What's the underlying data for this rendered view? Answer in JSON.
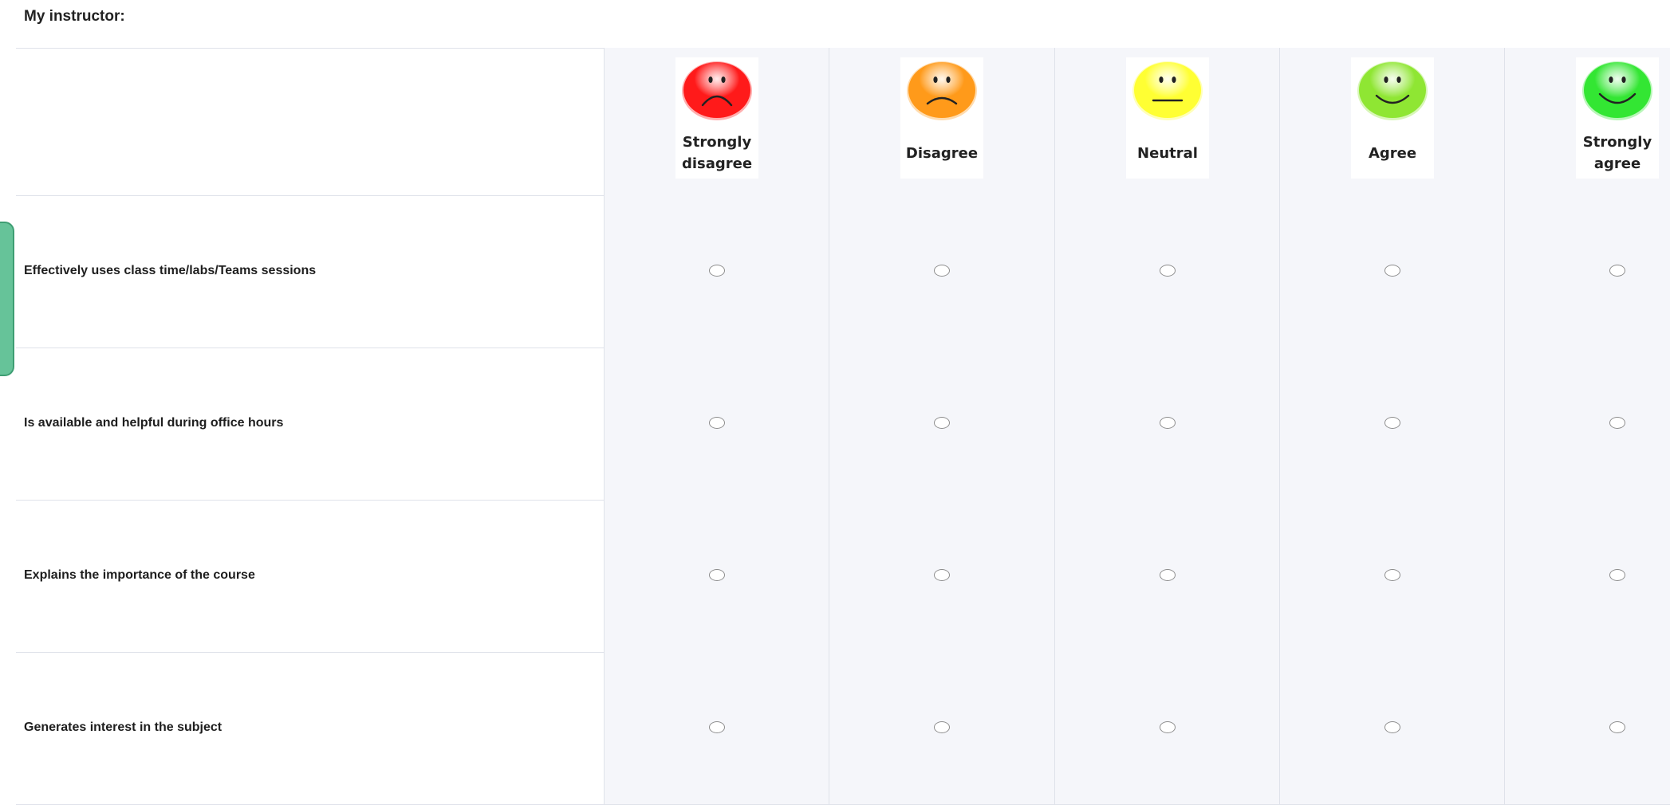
{
  "question": {
    "title": "My instructor:"
  },
  "scale": [
    {
      "label": "Strongly disagree",
      "icon": "very-sad-face-icon",
      "color": "#ff1a1a",
      "mood": "very-sad"
    },
    {
      "label": "Disagree",
      "icon": "sad-face-icon",
      "color": "#ff9a1a",
      "mood": "sad"
    },
    {
      "label": "Neutral",
      "icon": "neutral-face-icon",
      "color": "#ffff33",
      "mood": "neutral"
    },
    {
      "label": "Agree",
      "icon": "happy-face-icon",
      "color": "#8fe633",
      "mood": "happy"
    },
    {
      "label": "Strongly agree",
      "icon": "very-happy-face-icon",
      "color": "#33e633",
      "mood": "very-happy"
    }
  ],
  "statements": [
    {
      "label": "Effectively uses class time/labs/Teams sessions",
      "selected": null
    },
    {
      "label": "Is available and helpful during office hours",
      "selected": null
    },
    {
      "label": "Explains the importance of the course",
      "selected": null
    },
    {
      "label": "Generates interest in the subject",
      "selected": null
    }
  ],
  "colors": {
    "cell_background": "#f5f6fa",
    "grid_line": "#dfe2ea",
    "side_tab": "#66c399"
  }
}
